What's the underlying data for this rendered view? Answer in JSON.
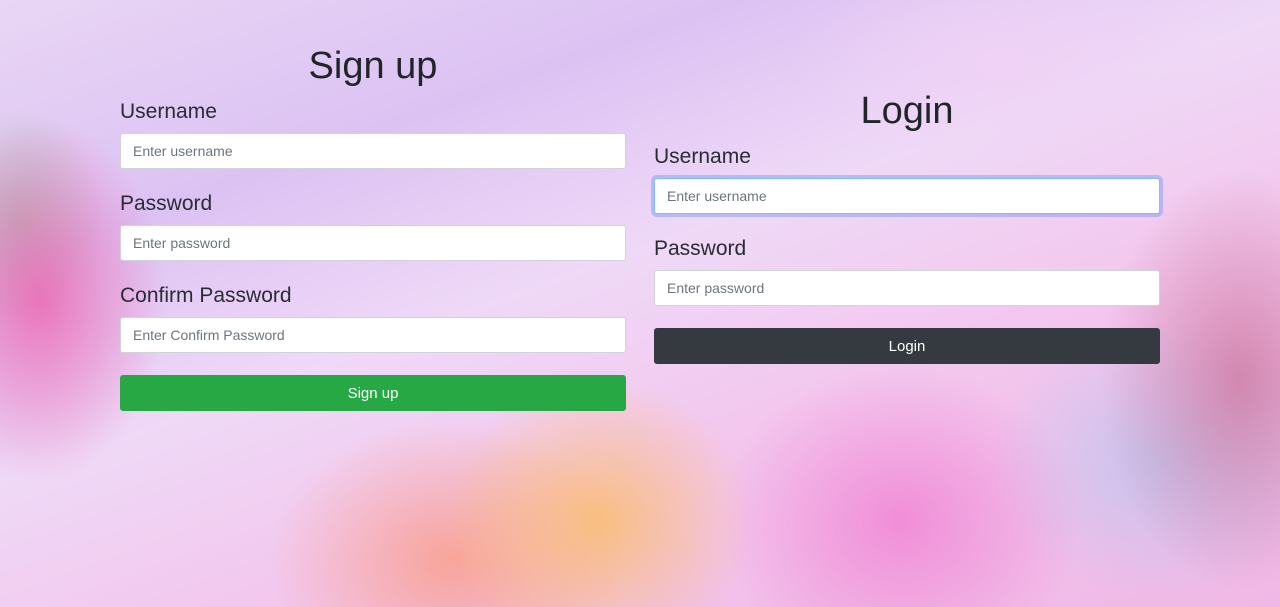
{
  "signup": {
    "title": "Sign up",
    "username_label": "Username",
    "username_placeholder": "Enter username",
    "password_label": "Password",
    "password_placeholder": "Enter password",
    "confirm_label": "Confirm Password",
    "confirm_placeholder": "Enter Confirm Password",
    "button_label": "Sign up",
    "button_color": "#28a745"
  },
  "login": {
    "title": "Login",
    "username_label": "Username",
    "username_placeholder": "Enter username",
    "password_label": "Password",
    "password_placeholder": "Enter password",
    "button_label": "Login",
    "button_color": "#343a40"
  }
}
